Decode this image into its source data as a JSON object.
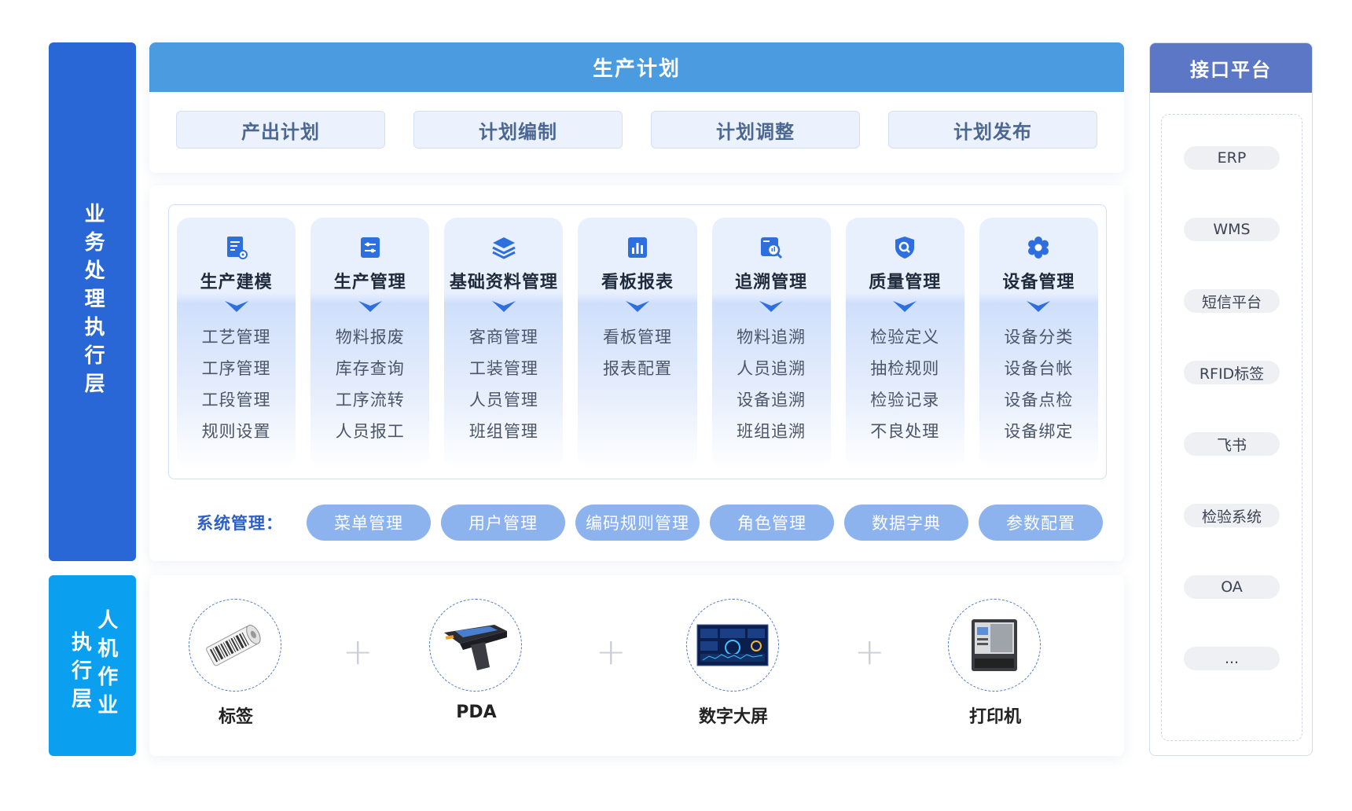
{
  "layers": {
    "business": "业务处理执行层",
    "hmi_col1": "人机作业",
    "hmi_col2": "执行层"
  },
  "plan": {
    "title": "生产计划",
    "items": [
      "产出计划",
      "计划编制",
      "计划调整",
      "计划发布"
    ]
  },
  "modules": [
    {
      "title": "生产建模",
      "icon": "document-gear-icon",
      "items": [
        "工艺管理",
        "工序管理",
        "工段管理",
        "规则设置"
      ]
    },
    {
      "title": "生产管理",
      "icon": "sliders-icon",
      "items": [
        "物料报废",
        "库存查询",
        "工序流转",
        "人员报工"
      ]
    },
    {
      "title": "基础资料管理",
      "icon": "layers-icon",
      "items": [
        "客商管理",
        "工装管理",
        "人员管理",
        "班组管理"
      ]
    },
    {
      "title": "看板报表",
      "icon": "bar-chart-icon",
      "items": [
        "看板管理",
        "报表配置"
      ]
    },
    {
      "title": "追溯管理",
      "icon": "trace-search-icon",
      "items": [
        "物料追溯",
        "人员追溯",
        "设备追溯",
        "班组追溯"
      ]
    },
    {
      "title": "质量管理",
      "icon": "shield-search-icon",
      "items": [
        "检验定义",
        "抽检规则",
        "检验记录",
        "不良处理"
      ]
    },
    {
      "title": "设备管理",
      "icon": "gear-icon",
      "items": [
        "设备分类",
        "设备台帐",
        "设备点检",
        "设备绑定"
      ]
    }
  ],
  "system": {
    "label": "系统管理：",
    "items": [
      "菜单管理",
      "用户管理",
      "编码规则管理",
      "角色管理",
      "数据字典",
      "参数配置"
    ]
  },
  "devices": [
    {
      "name": "标签",
      "icon": "label-roll-icon"
    },
    {
      "name": "PDA",
      "icon": "pda-scanner-icon"
    },
    {
      "name": "数字大屏",
      "icon": "dashboard-screen-icon"
    },
    {
      "name": "打印机",
      "icon": "printer-icon"
    }
  ],
  "plus_sign": "+",
  "interface": {
    "title": "接口平台",
    "items": [
      "ERP",
      "WMS",
      "短信平台",
      "RFID标签",
      "飞书",
      "检验系统",
      "OA",
      "..."
    ]
  },
  "colors": {
    "business_layer": "#2a67d6",
    "hmi_layer": "#0b9ff0",
    "plan_header": "#4a9be0",
    "interface_header": "#5b77c6",
    "system_pill": "#8db3ee",
    "icon_blue": "#2e6fe0"
  }
}
